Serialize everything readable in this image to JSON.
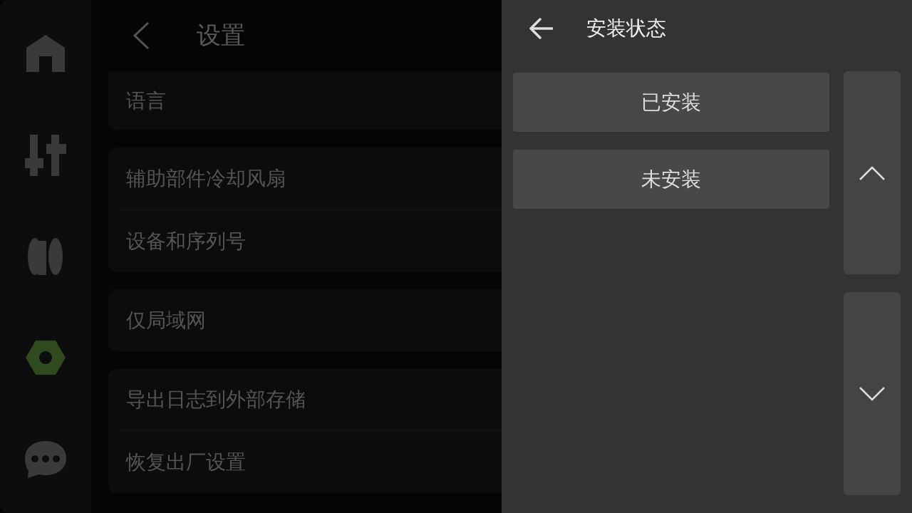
{
  "sidebar": {
    "items": [
      {
        "kind": "home",
        "selected": false
      },
      {
        "kind": "sliders",
        "selected": false
      },
      {
        "kind": "spool",
        "selected": false
      },
      {
        "kind": "nut",
        "selected": true
      },
      {
        "kind": "chat",
        "selected": false
      }
    ]
  },
  "settings": {
    "title": "设置",
    "groups": [
      {
        "items": [
          "语言"
        ]
      },
      {
        "items": [
          "辅助部件冷却风扇",
          "设备和序列号"
        ]
      },
      {
        "items": [
          "仅局域网"
        ]
      },
      {
        "items": [
          "导出日志到外部存储",
          "恢复出厂设置"
        ]
      }
    ]
  },
  "panel": {
    "title": "安装状态",
    "options": [
      "已安装",
      "未安装"
    ]
  }
}
